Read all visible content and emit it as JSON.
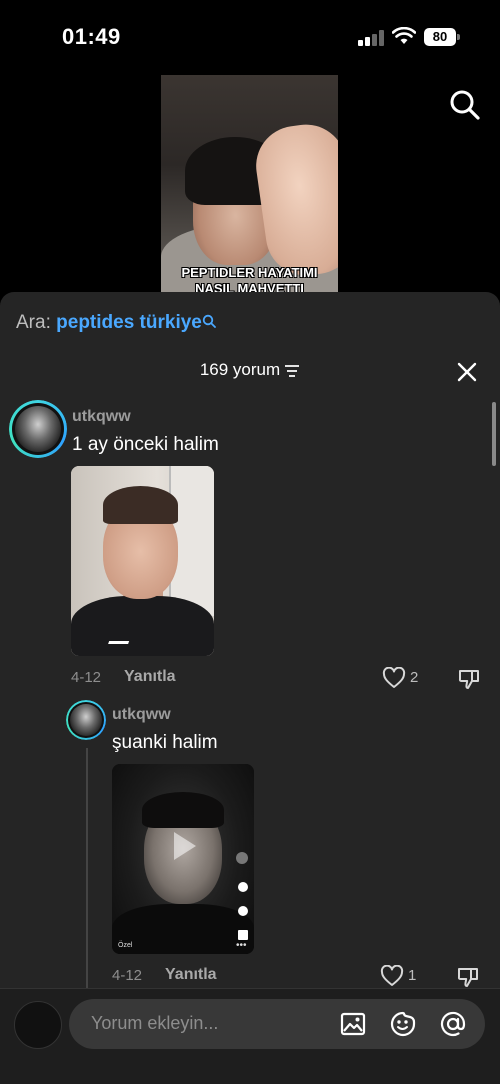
{
  "status_bar": {
    "time": "01:49",
    "battery": "80"
  },
  "video": {
    "caption_line1": "PEPTIDLER HAYATIMI",
    "caption_line2": "NASIL MAHVETTI"
  },
  "search": {
    "label": "Ara:",
    "term": "peptides türkiye"
  },
  "comments_header": {
    "count_label": "169 yorum"
  },
  "comments": [
    {
      "username": "utkqww",
      "text": "1 ay önceki halim",
      "date": "4-12",
      "reply_label": "Yanıtla",
      "likes": "2"
    },
    {
      "username": "utkqww",
      "text": "şuanki halim",
      "date": "4-12",
      "reply_label": "Yanıtla",
      "likes": "1",
      "video_badge": "Özel"
    }
  ],
  "composer": {
    "placeholder": "Yorum ekleyin..."
  },
  "icons": [
    "search-icon",
    "filter-icon",
    "close-icon",
    "heart-icon",
    "dislike-icon",
    "image-icon",
    "emoji-icon",
    "mention-icon"
  ],
  "colors": {
    "accent": "#4aa8ff",
    "sheet": "#252525",
    "ring": "#3fd5e3"
  }
}
